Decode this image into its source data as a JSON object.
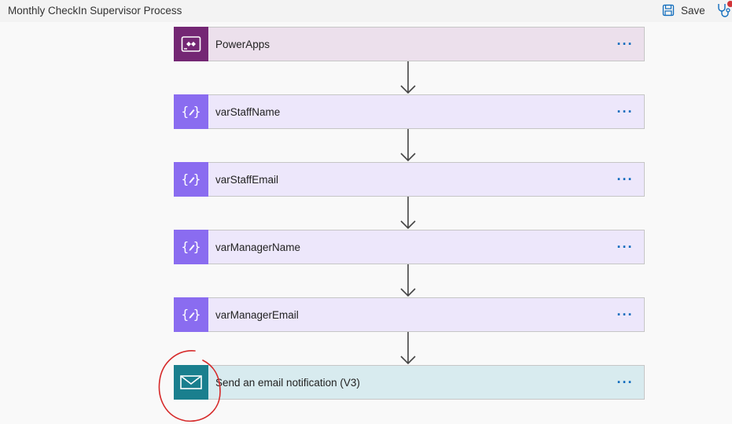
{
  "header": {
    "title": "Monthly CheckIn Supervisor Process",
    "save_label": "Save"
  },
  "colors": {
    "powerapps_icon": "#742774",
    "powerapps_card": "#ece0ec",
    "variable_icon": "#8a6cf0",
    "variable_card": "#ede7fb",
    "notification_icon": "#1a7f8e",
    "notification_card": "#d8ebef",
    "more_dots": "#0f6cbd",
    "annotation": "#d62a2a"
  },
  "steps": [
    {
      "label": "PowerApps",
      "icon": "powerapps-icon",
      "more": "···"
    },
    {
      "label": "varStaffName",
      "icon": "variable-icon",
      "more": "···"
    },
    {
      "label": "varStaffEmail",
      "icon": "variable-icon",
      "more": "···"
    },
    {
      "label": "varManagerName",
      "icon": "variable-icon",
      "more": "···"
    },
    {
      "label": "varManagerEmail",
      "icon": "variable-icon",
      "more": "···"
    },
    {
      "label": "Send an email notification (V3)",
      "icon": "mail-icon",
      "more": "···"
    }
  ]
}
